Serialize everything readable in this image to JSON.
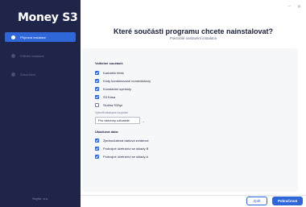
{
  "app": {
    "logo_text": "Money S3"
  },
  "window_controls": {
    "minimize": "–",
    "close": "✕"
  },
  "sidebar": {
    "items": [
      {
        "label": "Příprava instalace",
        "active": true
      },
      {
        "label": "Průběh instalace",
        "active": false
      },
      {
        "label": "Dokončení",
        "active": false
      }
    ],
    "footer": "Seyfor, a.s."
  },
  "main": {
    "title": "Které součásti programu chcete nainstalovat?",
    "subtitle": "Pokročilé nastavení instalace",
    "optional_section": "Volitelné součásti:",
    "optional_items": [
      {
        "label": "Kartotéki řetek",
        "checked": true
      },
      {
        "label": "Kódy kombinované nomenklatury",
        "checked": true
      },
      {
        "label": "Konstantní symboly",
        "checked": true
      },
      {
        "label": "S3 Kasa",
        "checked": true
      },
      {
        "label": "Služba S3Api",
        "checked": false
      }
    ],
    "shortcut_label": "Vytvořit zástupce na ploše",
    "shortcut_value": "Pro všechny uživatele",
    "sample_section": "Ukázková data:",
    "sample_items": [
      {
        "label": "Zjednodušená daňová evidence",
        "checked": true
      },
      {
        "label": "Podvojné účetnictví se sklady B",
        "checked": true
      },
      {
        "label": "Podvojné účetnictví se sklady A",
        "checked": true
      }
    ]
  },
  "buttons": {
    "back": "Zpět",
    "next": "Pokračovat"
  },
  "colors": {
    "sidebar": "#1f2548",
    "accent": "#2f66d8"
  }
}
